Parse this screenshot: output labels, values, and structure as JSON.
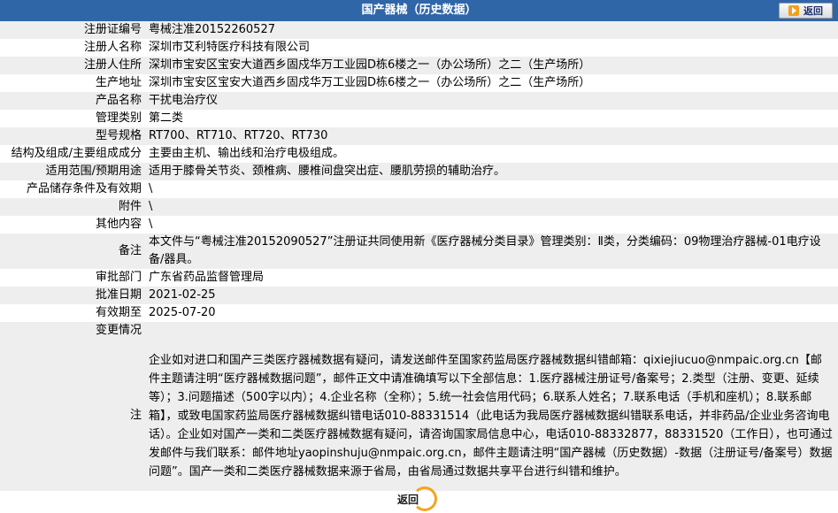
{
  "header": {
    "title": "国产器械（历史数据）",
    "back_label": "返回"
  },
  "rows": [
    {
      "label": "注册证编号",
      "value": "粤械注准20152260527"
    },
    {
      "label": "注册人名称",
      "value": "深圳市艾利特医疗科技有限公司"
    },
    {
      "label": "注册人住所",
      "value": "深圳市宝安区宝安大道西乡固戍华万工业园D栋6楼之一（办公场所）之二（生产场所）"
    },
    {
      "label": "生产地址",
      "value": "深圳市宝安区宝安大道西乡固戍华万工业园D栋6楼之一（办公场所）之二（生产场所）"
    },
    {
      "label": "产品名称",
      "value": "干扰电治疗仪"
    },
    {
      "label": "管理类别",
      "value": "第二类"
    },
    {
      "label": "型号规格",
      "value": "RT700、RT710、RT720、RT730"
    },
    {
      "label": "结构及组成/主要组成成分",
      "value": "主要由主机、输出线和治疗电极组成。"
    },
    {
      "label": "适用范围/预期用途",
      "value": "适用于膝骨关节炎、颈椎病、腰椎间盘突出症、腰肌劳损的辅助治疗。"
    },
    {
      "label": "产品储存条件及有效期",
      "value": "\\"
    },
    {
      "label": "附件",
      "value": "\\"
    },
    {
      "label": "其他内容",
      "value": "\\"
    },
    {
      "label": "备注",
      "value": "本文件与“粤械注准20152090527”注册证共同使用新《医疗器械分类目录》管理类别：Ⅱ类，分类编码：09物理治疗器械-01电疗设备/器具。"
    },
    {
      "label": "审批部门",
      "value": "广东省药品监督管理局"
    },
    {
      "label": "批准日期",
      "value": "2021-02-25"
    },
    {
      "label": "有效期至",
      "value": "2025-07-20"
    },
    {
      "label": "变更情况",
      "value": ""
    },
    {
      "label": "注",
      "value": "企业如对进口和国产三类医疗器械数据有疑问，请发送邮件至国家药监局医疗器械数据纠错邮箱：qixiejiucuo@nmpaic.org.cn【邮件主题请注明“医疗器械数据问题”，邮件正文中请准确填写以下全部信息：1.医疗器械注册证号/备案号；2.类型（注册、变更、延续等）；3.问题描述（500字以内）；4.企业名称（全称）；5.统一社会信用代码；6.联系人姓名；7.联系电话（手机和座机）；8.联系邮箱】，或致电国家药监局医疗器械数据纠错电话010-88331514（此电话为我局医疗器械数据纠错联系电话，并非药品/企业业务咨询电话）。企业如对国产一类和二类医疗器械数据有疑问，请咨询国家局信息中心，电话010-88332877，88331520（工作日），也可通过发邮件与我们联系：邮件地址yaopinshuju@nmpaic.org.cn，邮件主题请注明“国产器械（历史数据）-数据（注册证号/备案号）数据问题”。国产一类和二类医疗器械数据来源于省局，由省局通过数据共享平台进行纠错和维护。"
    }
  ],
  "bottom": {
    "back_label": "返回"
  }
}
